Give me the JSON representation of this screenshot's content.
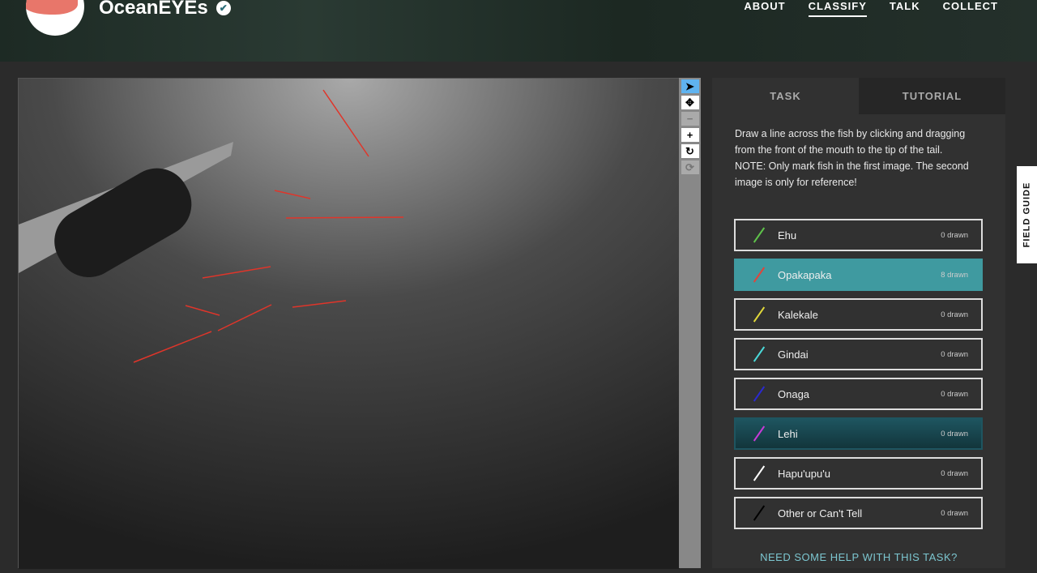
{
  "header": {
    "title": "OceanEYEs",
    "nav": [
      "ABOUT",
      "CLASSIFY",
      "TALK",
      "COLLECT"
    ]
  },
  "panel": {
    "tabs": [
      "TASK",
      "TUTORIAL"
    ],
    "instructions": "Draw a line across the fish by clicking and dragging from the front of the mouth to the tip of the tail.",
    "note": "NOTE: Only mark fish in the first image. The second image is only for reference!",
    "choices": [
      {
        "label": "Ehu",
        "count": "0 drawn",
        "color": "#5ec24a"
      },
      {
        "label": "Opakapaka",
        "count": "8 drawn",
        "color": "#e0443a"
      },
      {
        "label": "Kalekale",
        "count": "0 drawn",
        "color": "#e0d83a"
      },
      {
        "label": "Gindai",
        "count": "0 drawn",
        "color": "#4ad8d8"
      },
      {
        "label": "Onaga",
        "count": "0 drawn",
        "color": "#2a2ad0"
      },
      {
        "label": "Lehi",
        "count": "0 drawn",
        "color": "#c83ad8"
      },
      {
        "label": "Hapu'upu'u",
        "count": "0 drawn",
        "color": "#ffffff"
      },
      {
        "label": "Other or Can't Tell",
        "count": "0 drawn",
        "color": "#000000"
      }
    ],
    "help": "NEED SOME HELP WITH THIS TASK?"
  },
  "field_guide": "FIELD GUIDE"
}
